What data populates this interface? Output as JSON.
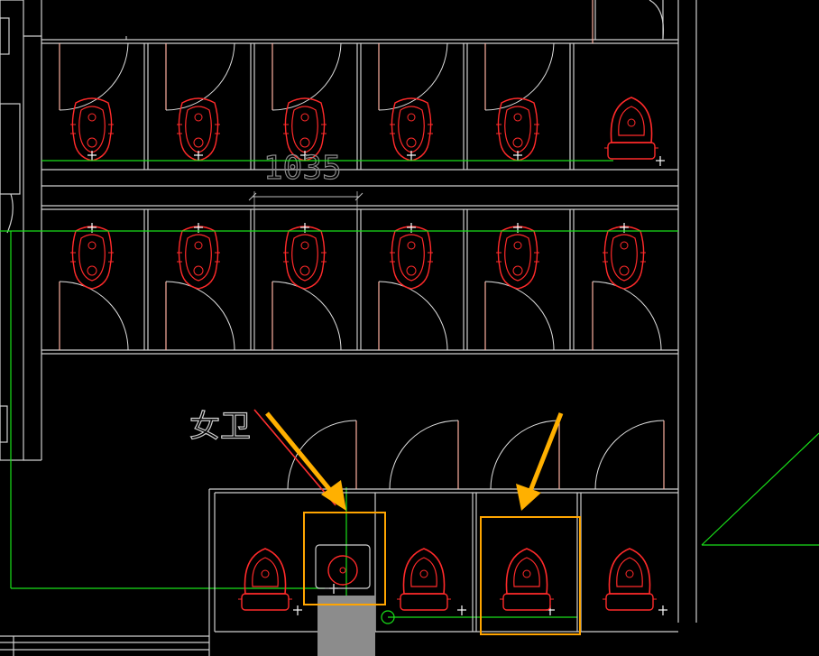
{
  "drawing": {
    "dimension_label": "1035",
    "room_label": "女卫",
    "colors": {
      "background": "#000000",
      "wall": "#d8d8d8",
      "fixture": "#ff2a2a",
      "door": "#ffffff",
      "guide_line": "#19e019",
      "highlight": "#ffa500",
      "arrow": "#ffb000",
      "leader": "#ff3030",
      "block": "#8c8c8c"
    },
    "fixtures": {
      "top_row": [
        "squat-toilet",
        "squat-toilet",
        "squat-toilet",
        "squat-toilet",
        "squat-toilet",
        "sitting-toilet"
      ],
      "middle_row": [
        "squat-toilet",
        "squat-toilet",
        "squat-toilet",
        "squat-toilet",
        "squat-toilet",
        "squat-toilet"
      ],
      "bottom_row": [
        "sitting-toilet",
        "accessible-fixture",
        "sitting-toilet",
        "sitting-toilet",
        "sitting-toilet"
      ]
    },
    "highlighted_stalls": 2,
    "arrows": 2
  }
}
